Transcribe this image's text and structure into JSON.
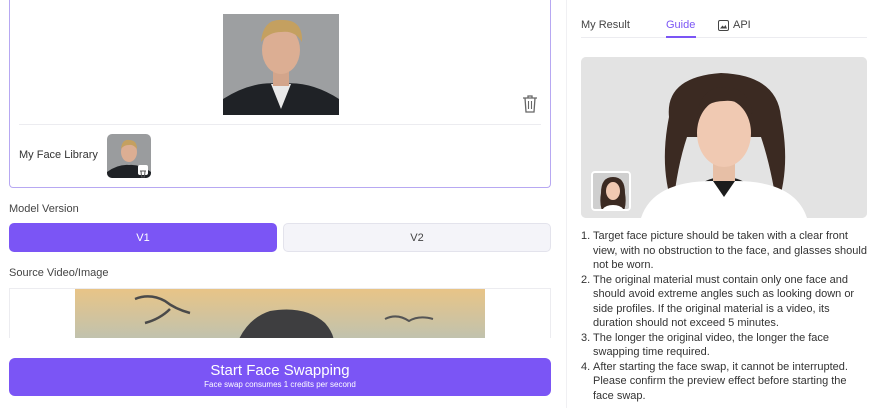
{
  "face_card": {
    "library_label": "My Face Library"
  },
  "model_version": {
    "label": "Model Version",
    "options": [
      "V1",
      "V2"
    ],
    "selected": "V1"
  },
  "source": {
    "label": "Source Video/Image"
  },
  "start_button": {
    "title": "Start Face Swapping",
    "subtitle": "Face swap consumes 1 credits per second"
  },
  "tabs": [
    {
      "label": "My Result"
    },
    {
      "label": "Guide"
    },
    {
      "label": "API"
    }
  ],
  "active_tab": "Guide",
  "guide": {
    "steps": [
      {
        "num": "1.",
        "text": "Target face picture should be taken with a clear front view, with no obstruction to the face, and glasses should not be worn."
      },
      {
        "num": "2.",
        "text": "The original material must contain only one face and should avoid extreme angles such as looking down or side profiles. If the original material is a video, its duration should not exceed 5 minutes."
      },
      {
        "num": "3.",
        "text": "The longer the original video, the longer the face swapping time required."
      },
      {
        "num": "4.",
        "text": "After starting the face swap, it cannot be interrupted. Please confirm the preview effect before starting the face swap."
      }
    ]
  },
  "colors": {
    "accent": "#7b55f5",
    "border_accent": "#b7a8f2"
  },
  "icons": [
    "trash-icon",
    "image-icon"
  ]
}
